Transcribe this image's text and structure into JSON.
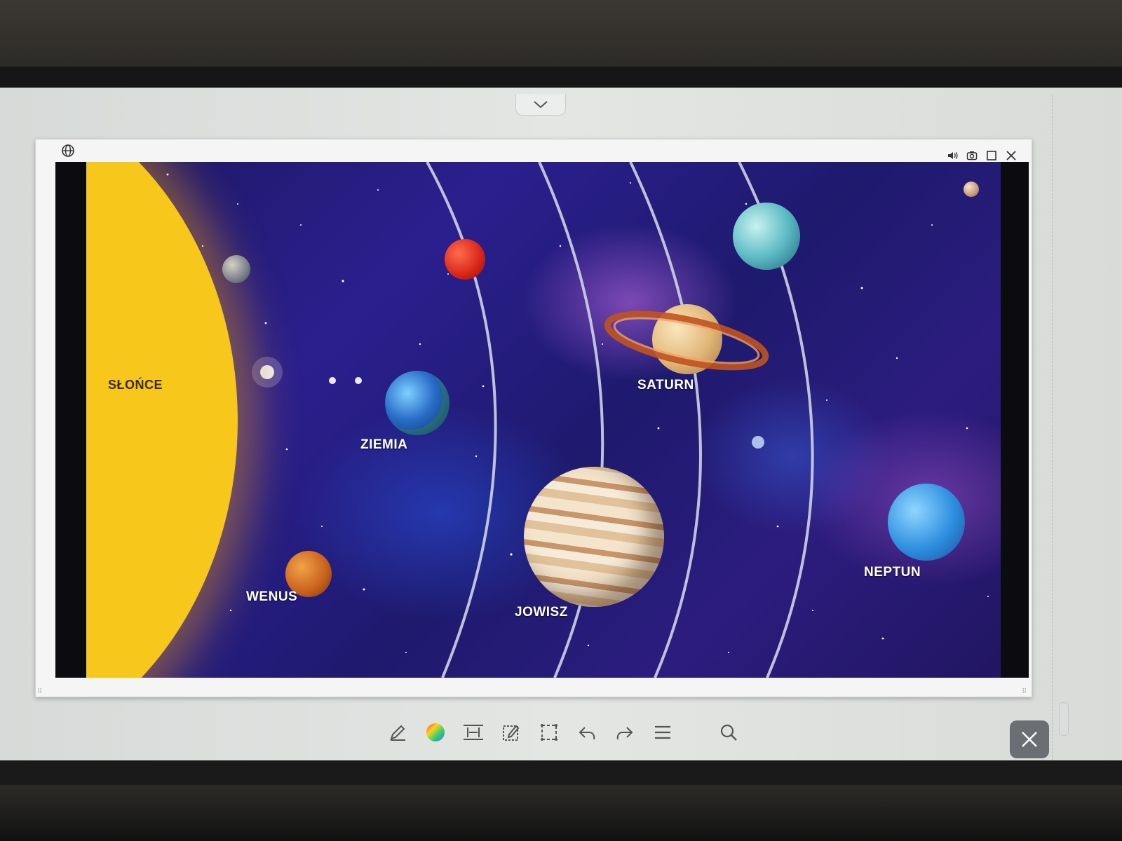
{
  "solar_system": {
    "labels": {
      "sun": "SŁOŃCE",
      "earth": "ZIEMIA",
      "venus": "WENUS",
      "jupiter": "JOWISZ",
      "saturn": "SATURN",
      "neptune": "NEPTUN"
    }
  },
  "icons": {
    "browser": "globe-icon",
    "window_controls": [
      "speaker-icon",
      "camera-icon",
      "maximize-icon",
      "close-icon"
    ],
    "toolbar": [
      "pen-icon",
      "color-picker-icon",
      "fit-width-icon",
      "edit-note-icon",
      "selection-icon",
      "undo-icon",
      "redo-icon",
      "menu-icon",
      "search-icon"
    ],
    "dismiss": "close-icon",
    "pull_down": "chevron-down-icon"
  },
  "colors": {
    "sun": "#f5c218",
    "toolbar_icon": "#555555",
    "close_button": "#6b6e72"
  }
}
